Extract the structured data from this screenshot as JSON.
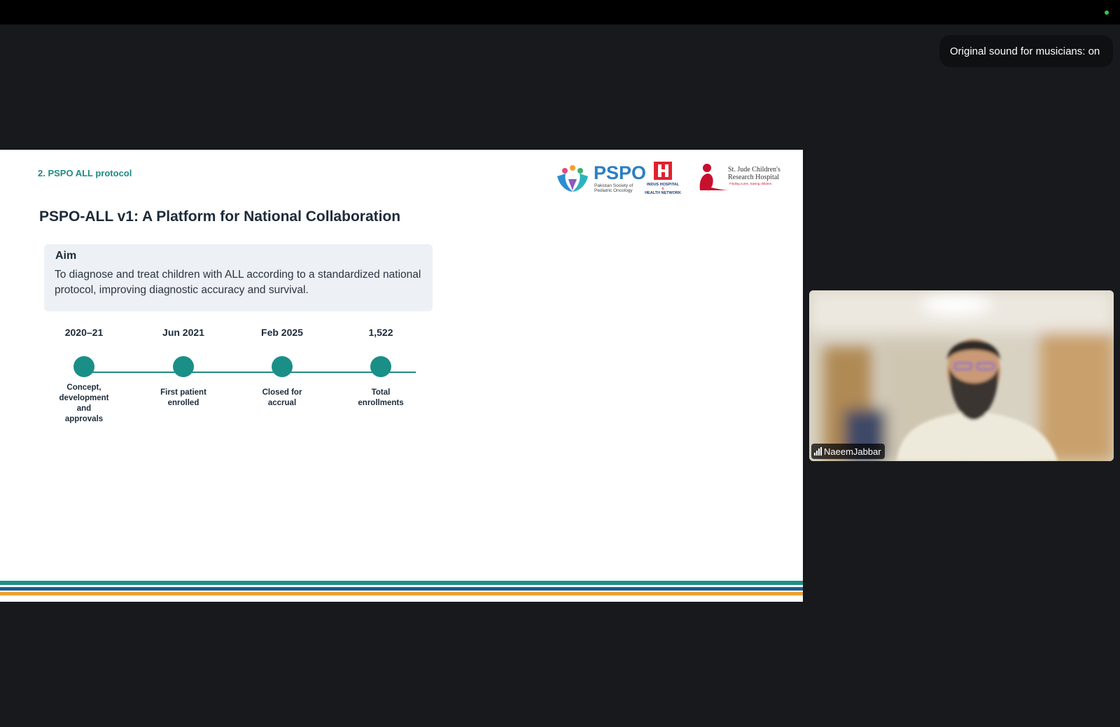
{
  "meeting": {
    "toast": "Original sound for musicians: on"
  },
  "slide": {
    "section": "2. PSPO ALL protocol",
    "title": "PSPO-ALL v1: A Platform for National Collaboration",
    "logos": {
      "pspo": "PSPO",
      "pspo_sub1": "Pakistan Society of",
      "pspo_sub2": "Pediatric Oncology",
      "indus1": "INDUS HOSPITAL",
      "indus2": "&",
      "indus3": "HEALTH NETWORK",
      "stjude1": "St. Jude Children's",
      "stjude2": "Research Hospital",
      "stjude3": "Finding cures. Saving children."
    },
    "aim": {
      "heading": "Aim",
      "text": "To diagnose and treat children with ALL according to a standardized national protocol, improving diagnostic accuracy and survival."
    },
    "timeline": [
      {
        "year": "2020–21",
        "label": "Concept, development and approvals"
      },
      {
        "year": "Jun 2021",
        "label": "First patient enrolled"
      },
      {
        "year": "Feb 2025",
        "label": "Closed for accrual"
      },
      {
        "year": "1,522",
        "label": "Total enrollments"
      }
    ],
    "colors": {
      "teal": "#1f8a84",
      "stripe_teal": "#1a8f87",
      "stripe_blue": "#1d5f8c",
      "stripe_orange": "#f0a030"
    }
  },
  "participant": {
    "name": "NaeemJabbar"
  }
}
